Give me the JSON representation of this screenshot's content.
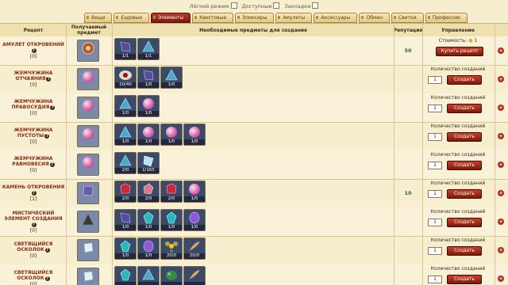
{
  "filters": {
    "easy": "Лёгкий режим",
    "available": "Доступные",
    "bookmarks": "Закладки"
  },
  "tabs": [
    {
      "label": "Вещи",
      "active": false
    },
    {
      "label": "Ездовые",
      "active": false
    },
    {
      "label": "Элементы",
      "active": true
    },
    {
      "label": "Квестовые",
      "active": false
    },
    {
      "label": "Эликсиры",
      "active": false
    },
    {
      "label": "Амулеты",
      "active": false
    },
    {
      "label": "Аксессуары",
      "active": false
    },
    {
      "label": "Обмен",
      "active": false
    },
    {
      "label": "Свитки",
      "active": false
    },
    {
      "label": "Профессии",
      "active": false
    }
  ],
  "headers": {
    "recipe": "Рецепт",
    "result": "Получаемый предмет",
    "required": "Необходимые предметы для создания",
    "reputation": "Репутация",
    "management": "Управление"
  },
  "labels": {
    "cost": "Стоимость:",
    "buy": "Купить рецепт",
    "created": "Количество созданий",
    "create": "Создать"
  },
  "rows": [
    {
      "name": "АМУЛЕТ ОТКРОВЕНИЙ",
      "count": "[0]",
      "result": "amulet",
      "reputation": "50",
      "cost": "1",
      "buy": true,
      "qty": "",
      "items": [
        {
          "gem": "violet-shard",
          "label": "1/1"
        },
        {
          "gem": "blue-shard",
          "label": "1/1"
        }
      ]
    },
    {
      "name": "ЖЕМЧУЖИНА ОТЧАЯНИЯ",
      "count": "[0]",
      "result": "pink-pearl",
      "reputation": "",
      "buy": false,
      "qty": "1",
      "items": [
        {
          "gem": "eye",
          "label": "10/40"
        },
        {
          "gem": "violet-shard",
          "label": "1/0"
        },
        {
          "gem": "blue-shard",
          "label": "1/0"
        }
      ]
    },
    {
      "name": "ЖЕМЧУЖИНА ПРАВОСУДИЯ",
      "count": "[0]",
      "result": "dark-pearl",
      "reputation": "",
      "buy": false,
      "qty": "1",
      "items": [
        {
          "gem": "blue-shard",
          "label": "1/0"
        },
        {
          "gem": "pink-pearl",
          "label": "1/0"
        }
      ]
    },
    {
      "name": "ЖЕМЧУЖИНА ПУСТОТЫ",
      "count": "[0]",
      "result": "purple-pearl",
      "reputation": "",
      "buy": false,
      "qty": "1",
      "items": [
        {
          "gem": "blue-shard",
          "label": "1/0"
        },
        {
          "gem": "dark-pearl",
          "label": "1/0"
        },
        {
          "gem": "pink-pearl",
          "label": "1/0"
        },
        {
          "gem": "green-pearl",
          "label": "1/0"
        }
      ]
    },
    {
      "name": "ЖЕМЧУЖИНА РАВНОВЕСИЯ",
      "count": "[0]",
      "result": "green-pearl",
      "reputation": "",
      "buy": false,
      "qty": "1",
      "items": [
        {
          "gem": "blue-shard",
          "label": "2/0"
        },
        {
          "gem": "ice-shard",
          "label": "1/165"
        }
      ]
    },
    {
      "name": "КАМЕНЬ ОТКРОВЕНИЯ",
      "count": "[1]",
      "result": "violet-stone",
      "reputation": "10",
      "buy": false,
      "qty": "1",
      "items": [
        {
          "gem": "red-crystal",
          "label": "2/0"
        },
        {
          "gem": "pink-crystal",
          "label": "2/0"
        },
        {
          "gem": "red-crystal",
          "label": "2/0"
        },
        {
          "gem": "purple-pearl",
          "label": "1/0"
        }
      ]
    },
    {
      "name": "МИСТИЧЕСКИЙ ЭЛЕМЕНТ СОЗДАНИЯ",
      "count": "[0]",
      "result": "dark-pyramid",
      "reputation": "",
      "buy": false,
      "qty": "1",
      "items": [
        {
          "gem": "violet-shard",
          "label": "1/0"
        },
        {
          "gem": "teal-gem",
          "label": "1/0"
        },
        {
          "gem": "teal-gem",
          "label": "1/0"
        },
        {
          "gem": "violet-gem",
          "label": "1/0"
        }
      ]
    },
    {
      "name": "СВЕТЯЩИЙСЯ ОСКОЛОК",
      "count": "[0]",
      "result": "white-shard",
      "reputation": "",
      "buy": false,
      "qty": "1",
      "items": [
        {
          "gem": "teal-gem",
          "label": "1/0"
        },
        {
          "gem": "violet-gem",
          "label": "1/0"
        },
        {
          "gem": "yellow-flower",
          "label": "20/0"
        },
        {
          "gem": "feather",
          "label": "20/0"
        }
      ]
    },
    {
      "name": "СВЕТЯЩИЙСЯ ОСКОЛОК",
      "count": "[0]",
      "result": "white-shard",
      "reputation": "",
      "buy": false,
      "qty": "1",
      "items": [
        {
          "gem": "teal-gem",
          "label": ""
        },
        {
          "gem": "blue-shard",
          "label": ""
        },
        {
          "gem": "green-moss",
          "label": ""
        },
        {
          "gem": "feather",
          "label": ""
        }
      ]
    }
  ]
}
